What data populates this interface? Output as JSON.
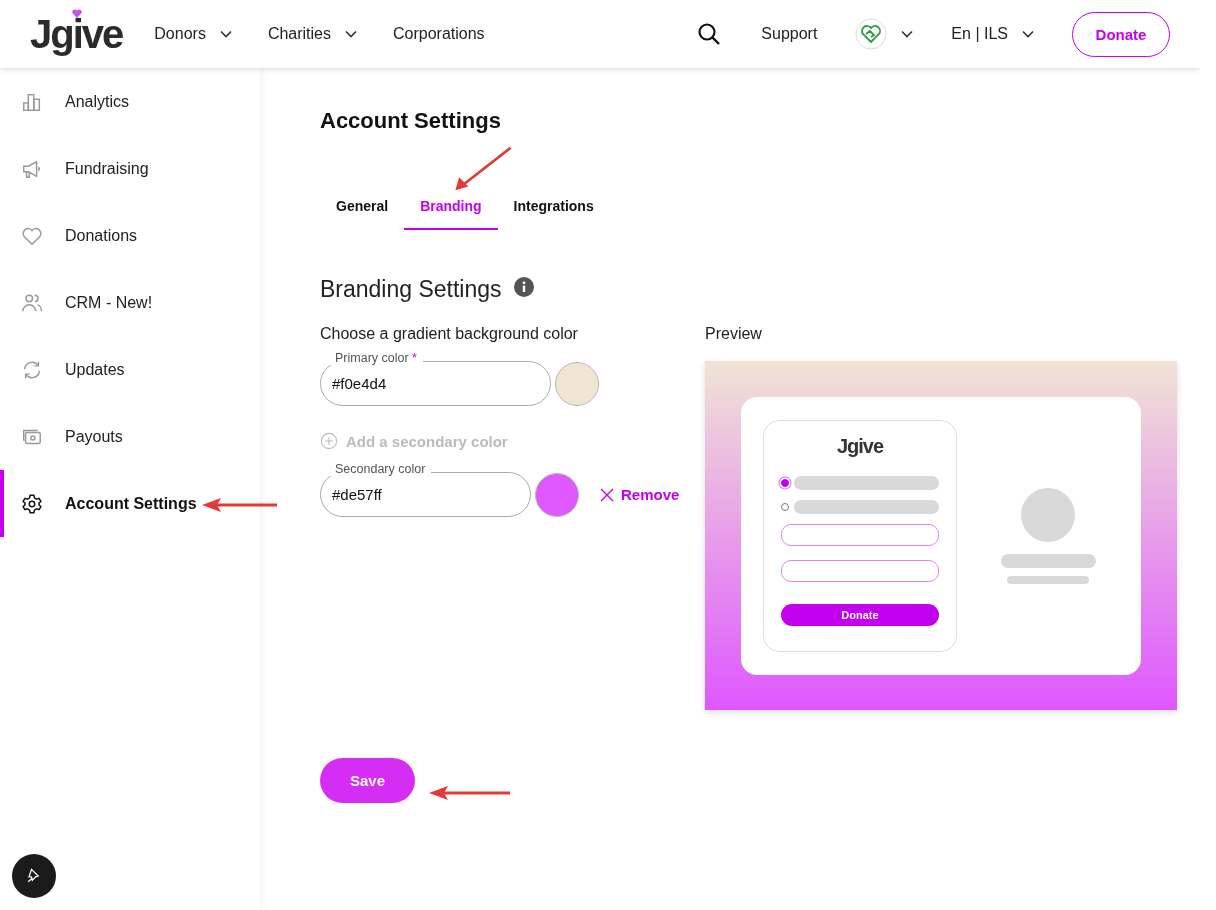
{
  "header": {
    "logo": "Jgive",
    "nav": [
      {
        "label": "Donors",
        "dropdown": true
      },
      {
        "label": "Charities",
        "dropdown": true
      },
      {
        "label": "Corporations",
        "dropdown": false
      }
    ],
    "support": "Support",
    "language": "En | ILS",
    "donate": "Donate"
  },
  "sidebar": {
    "items": [
      {
        "label": "Analytics",
        "selected": false
      },
      {
        "label": "Fundraising",
        "selected": false
      },
      {
        "label": "Donations",
        "selected": false
      },
      {
        "label": "CRM - New!",
        "selected": false
      },
      {
        "label": "Updates",
        "selected": false
      },
      {
        "label": "Payouts",
        "selected": false
      },
      {
        "label": "Account Settings",
        "selected": true
      }
    ]
  },
  "page": {
    "title": "Account Settings",
    "tabs": [
      {
        "label": "General",
        "selected": false
      },
      {
        "label": "Branding",
        "selected": true
      },
      {
        "label": "Integrations",
        "selected": false
      }
    ]
  },
  "branding": {
    "title": "Branding Settings",
    "subtitle": "Choose a gradient background color",
    "primary": {
      "label": "Primary color",
      "required_mark": "*",
      "value": "#f0e4d4",
      "color": "#f0e4d4"
    },
    "add_secondary": "Add a secondary color",
    "secondary": {
      "label": "Secondary color",
      "value": "#de57ff",
      "color": "#de57ff",
      "remove": "Remove"
    }
  },
  "preview": {
    "title": "Preview",
    "logo": "Jgive",
    "donate": "Donate"
  },
  "save": "Save"
}
